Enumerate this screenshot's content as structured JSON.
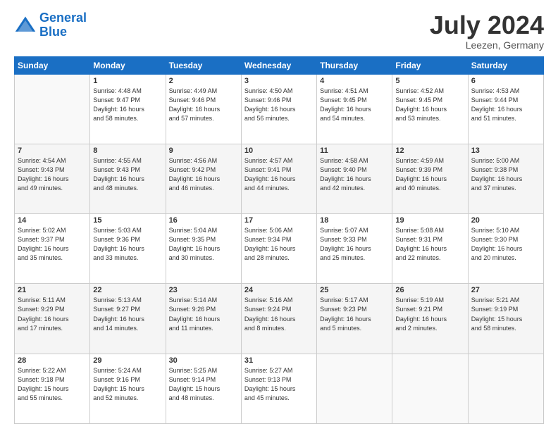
{
  "header": {
    "logo_line1": "General",
    "logo_line2": "Blue",
    "month_title": "July 2024",
    "subtitle": "Leezen, Germany"
  },
  "weekdays": [
    "Sunday",
    "Monday",
    "Tuesday",
    "Wednesday",
    "Thursday",
    "Friday",
    "Saturday"
  ],
  "weeks": [
    [
      {
        "num": "",
        "info": ""
      },
      {
        "num": "1",
        "info": "Sunrise: 4:48 AM\nSunset: 9:47 PM\nDaylight: 16 hours\nand 58 minutes."
      },
      {
        "num": "2",
        "info": "Sunrise: 4:49 AM\nSunset: 9:46 PM\nDaylight: 16 hours\nand 57 minutes."
      },
      {
        "num": "3",
        "info": "Sunrise: 4:50 AM\nSunset: 9:46 PM\nDaylight: 16 hours\nand 56 minutes."
      },
      {
        "num": "4",
        "info": "Sunrise: 4:51 AM\nSunset: 9:45 PM\nDaylight: 16 hours\nand 54 minutes."
      },
      {
        "num": "5",
        "info": "Sunrise: 4:52 AM\nSunset: 9:45 PM\nDaylight: 16 hours\nand 53 minutes."
      },
      {
        "num": "6",
        "info": "Sunrise: 4:53 AM\nSunset: 9:44 PM\nDaylight: 16 hours\nand 51 minutes."
      }
    ],
    [
      {
        "num": "7",
        "info": "Sunrise: 4:54 AM\nSunset: 9:43 PM\nDaylight: 16 hours\nand 49 minutes."
      },
      {
        "num": "8",
        "info": "Sunrise: 4:55 AM\nSunset: 9:43 PM\nDaylight: 16 hours\nand 48 minutes."
      },
      {
        "num": "9",
        "info": "Sunrise: 4:56 AM\nSunset: 9:42 PM\nDaylight: 16 hours\nand 46 minutes."
      },
      {
        "num": "10",
        "info": "Sunrise: 4:57 AM\nSunset: 9:41 PM\nDaylight: 16 hours\nand 44 minutes."
      },
      {
        "num": "11",
        "info": "Sunrise: 4:58 AM\nSunset: 9:40 PM\nDaylight: 16 hours\nand 42 minutes."
      },
      {
        "num": "12",
        "info": "Sunrise: 4:59 AM\nSunset: 9:39 PM\nDaylight: 16 hours\nand 40 minutes."
      },
      {
        "num": "13",
        "info": "Sunrise: 5:00 AM\nSunset: 9:38 PM\nDaylight: 16 hours\nand 37 minutes."
      }
    ],
    [
      {
        "num": "14",
        "info": "Sunrise: 5:02 AM\nSunset: 9:37 PM\nDaylight: 16 hours\nand 35 minutes."
      },
      {
        "num": "15",
        "info": "Sunrise: 5:03 AM\nSunset: 9:36 PM\nDaylight: 16 hours\nand 33 minutes."
      },
      {
        "num": "16",
        "info": "Sunrise: 5:04 AM\nSunset: 9:35 PM\nDaylight: 16 hours\nand 30 minutes."
      },
      {
        "num": "17",
        "info": "Sunrise: 5:06 AM\nSunset: 9:34 PM\nDaylight: 16 hours\nand 28 minutes."
      },
      {
        "num": "18",
        "info": "Sunrise: 5:07 AM\nSunset: 9:33 PM\nDaylight: 16 hours\nand 25 minutes."
      },
      {
        "num": "19",
        "info": "Sunrise: 5:08 AM\nSunset: 9:31 PM\nDaylight: 16 hours\nand 22 minutes."
      },
      {
        "num": "20",
        "info": "Sunrise: 5:10 AM\nSunset: 9:30 PM\nDaylight: 16 hours\nand 20 minutes."
      }
    ],
    [
      {
        "num": "21",
        "info": "Sunrise: 5:11 AM\nSunset: 9:29 PM\nDaylight: 16 hours\nand 17 minutes."
      },
      {
        "num": "22",
        "info": "Sunrise: 5:13 AM\nSunset: 9:27 PM\nDaylight: 16 hours\nand 14 minutes."
      },
      {
        "num": "23",
        "info": "Sunrise: 5:14 AM\nSunset: 9:26 PM\nDaylight: 16 hours\nand 11 minutes."
      },
      {
        "num": "24",
        "info": "Sunrise: 5:16 AM\nSunset: 9:24 PM\nDaylight: 16 hours\nand 8 minutes."
      },
      {
        "num": "25",
        "info": "Sunrise: 5:17 AM\nSunset: 9:23 PM\nDaylight: 16 hours\nand 5 minutes."
      },
      {
        "num": "26",
        "info": "Sunrise: 5:19 AM\nSunset: 9:21 PM\nDaylight: 16 hours\nand 2 minutes."
      },
      {
        "num": "27",
        "info": "Sunrise: 5:21 AM\nSunset: 9:19 PM\nDaylight: 15 hours\nand 58 minutes."
      }
    ],
    [
      {
        "num": "28",
        "info": "Sunrise: 5:22 AM\nSunset: 9:18 PM\nDaylight: 15 hours\nand 55 minutes."
      },
      {
        "num": "29",
        "info": "Sunrise: 5:24 AM\nSunset: 9:16 PM\nDaylight: 15 hours\nand 52 minutes."
      },
      {
        "num": "30",
        "info": "Sunrise: 5:25 AM\nSunset: 9:14 PM\nDaylight: 15 hours\nand 48 minutes."
      },
      {
        "num": "31",
        "info": "Sunrise: 5:27 AM\nSunset: 9:13 PM\nDaylight: 15 hours\nand 45 minutes."
      },
      {
        "num": "",
        "info": ""
      },
      {
        "num": "",
        "info": ""
      },
      {
        "num": "",
        "info": ""
      }
    ]
  ]
}
